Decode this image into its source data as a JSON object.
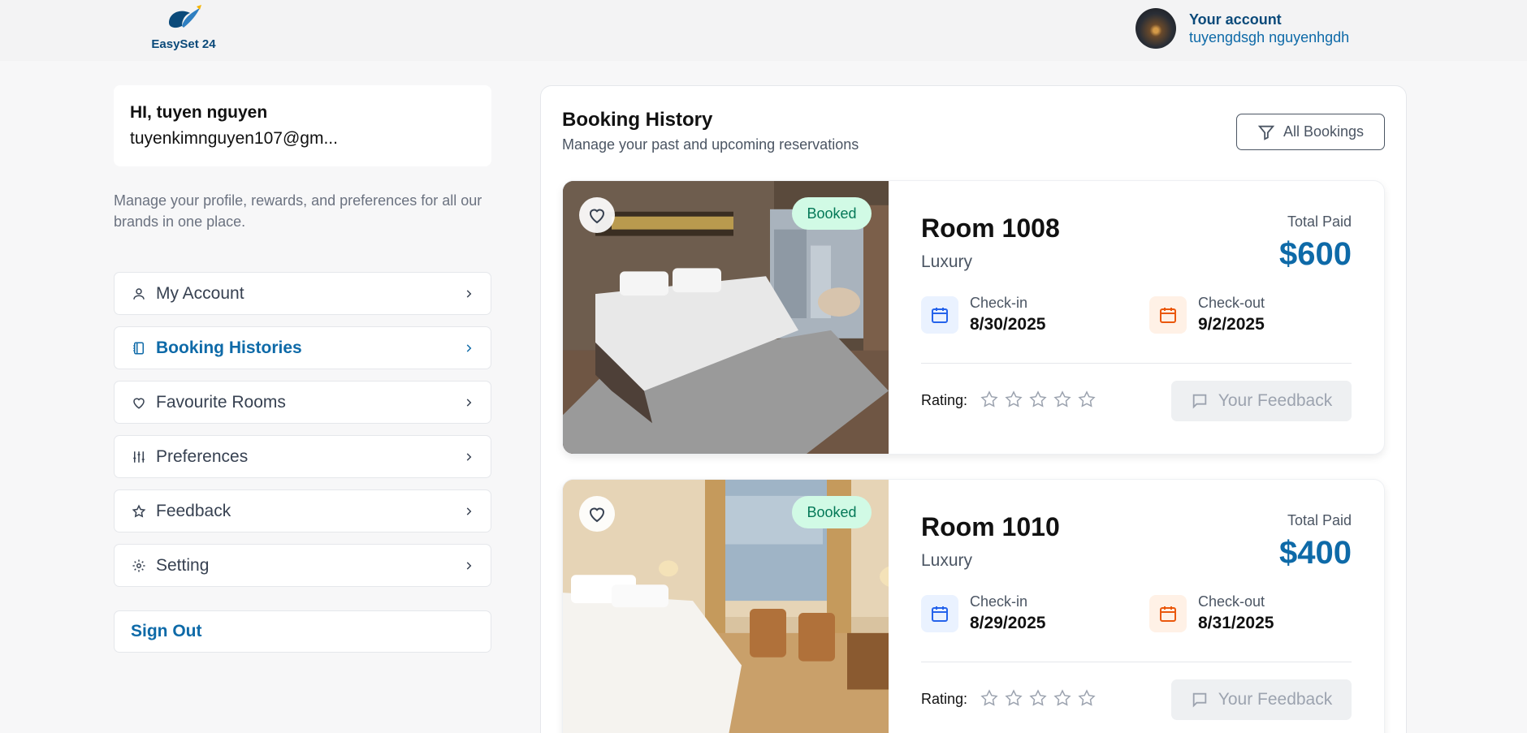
{
  "header": {
    "logo_text": "EasySet 24",
    "account_title": "Your account",
    "account_name": "tuyengdsgh nguyenhgdh"
  },
  "sidebar": {
    "greeting": "HI, tuyen nguyen",
    "email": "tuyenkimnguyen107@gm...",
    "description": "Manage your profile, rewards, and preferences for all our brands in one place.",
    "items": [
      {
        "label": "My Account",
        "icon": "user-icon",
        "active": false
      },
      {
        "label": "Booking Histories",
        "icon": "notebook-icon",
        "active": true
      },
      {
        "label": "Favourite Rooms",
        "icon": "heart-icon",
        "active": false
      },
      {
        "label": "Preferences",
        "icon": "sliders-icon",
        "active": false
      },
      {
        "label": "Feedback",
        "icon": "star-icon",
        "active": false
      },
      {
        "label": "Setting",
        "icon": "gear-icon",
        "active": false
      }
    ],
    "sign_out": "Sign Out"
  },
  "main": {
    "title": "Booking History",
    "subtitle": "Manage your past and upcoming reservations",
    "filter_label": "All Bookings",
    "bookings": [
      {
        "room": "Room 1008",
        "type": "Luxury",
        "status": "Booked",
        "total_label": "Total Paid",
        "total": "$600",
        "checkin_label": "Check-in",
        "checkin": "8/30/2025",
        "checkout_label": "Check-out",
        "checkout": "9/2/2025",
        "rating_label": "Rating:",
        "rating": 0,
        "feedback_label": "Your Feedback"
      },
      {
        "room": "Room 1010",
        "type": "Luxury",
        "status": "Booked",
        "total_label": "Total Paid",
        "total": "$400",
        "checkin_label": "Check-in",
        "checkin": "8/29/2025",
        "checkout_label": "Check-out",
        "checkout": "8/31/2025",
        "rating_label": "Rating:",
        "rating": 0,
        "feedback_label": "Your Feedback"
      }
    ]
  },
  "colors": {
    "brand": "#0e6aa8",
    "badge_bg": "#d1fae5",
    "badge_text": "#047857"
  }
}
